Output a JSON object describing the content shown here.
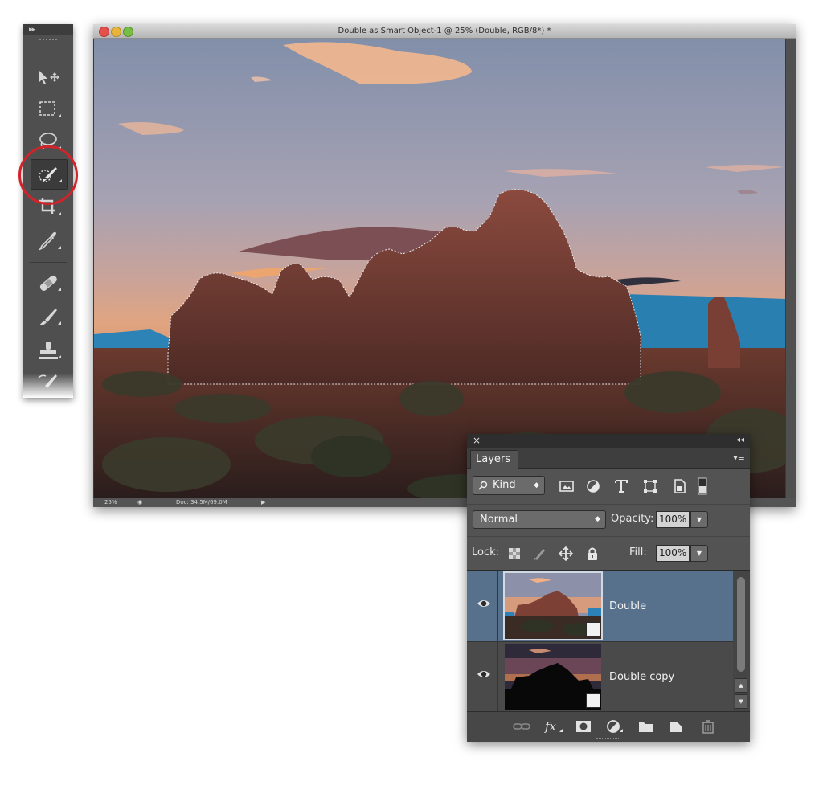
{
  "tools": {
    "collapse_arrows": "▸▸",
    "items": [
      {
        "name": "move-tool",
        "icon": "move-icon"
      },
      {
        "name": "rectangular-marquee-tool",
        "icon": "marquee-icon"
      },
      {
        "name": "lasso-tool",
        "icon": "lasso-icon"
      },
      {
        "name": "quick-selection-tool",
        "icon": "quick-selection-icon",
        "selected": true
      },
      {
        "name": "crop-tool",
        "icon": "crop-icon"
      },
      {
        "name": "eyedropper-tool",
        "icon": "eyedropper-icon"
      },
      {
        "name": "spot-healing-brush-tool",
        "icon": "bandage-icon"
      },
      {
        "name": "brush-tool",
        "icon": "brush-icon"
      },
      {
        "name": "clone-stamp-tool",
        "icon": "stamp-icon"
      },
      {
        "name": "history-brush-tool",
        "icon": "history-brush-icon"
      }
    ],
    "highlight_color": "#d2232a"
  },
  "document": {
    "title": "Double as Smart Object-1 @ 25% (Double, RGB/8*) *",
    "status": {
      "zoom": "25%",
      "doc_size": "Doc: 34.5M/69.0M"
    }
  },
  "layers_panel": {
    "close": "×",
    "collapse": "◂◂",
    "tab_label": "Layers",
    "menu_icon": "panel-menu-icon",
    "filter": {
      "kind_label": "Kind",
      "icons": [
        "pixel-filter-icon",
        "adjustment-filter-icon",
        "type-filter-icon",
        "shape-filter-icon",
        "smart-object-filter-icon",
        "filter-toggle-icon"
      ]
    },
    "blend_mode": "Normal",
    "opacity_label": "Opacity:",
    "opacity_value": "100%",
    "lock_label": "Lock:",
    "lock_icons": [
      "lock-transparent-icon",
      "lock-image-icon",
      "lock-position-icon",
      "lock-all-icon"
    ],
    "fill_label": "Fill:",
    "fill_value": "100%",
    "layers": [
      {
        "name": "Double",
        "visible": true,
        "selected": true,
        "smart_object": true
      },
      {
        "name": "Double copy",
        "visible": true,
        "selected": false,
        "smart_object": true
      }
    ],
    "footer_icons": [
      "link-layers-icon",
      "fx-icon",
      "mask-icon",
      "adjustment-layer-icon",
      "group-folder-icon",
      "new-layer-icon",
      "trash-icon"
    ],
    "selected_row_color": "#57718d"
  }
}
